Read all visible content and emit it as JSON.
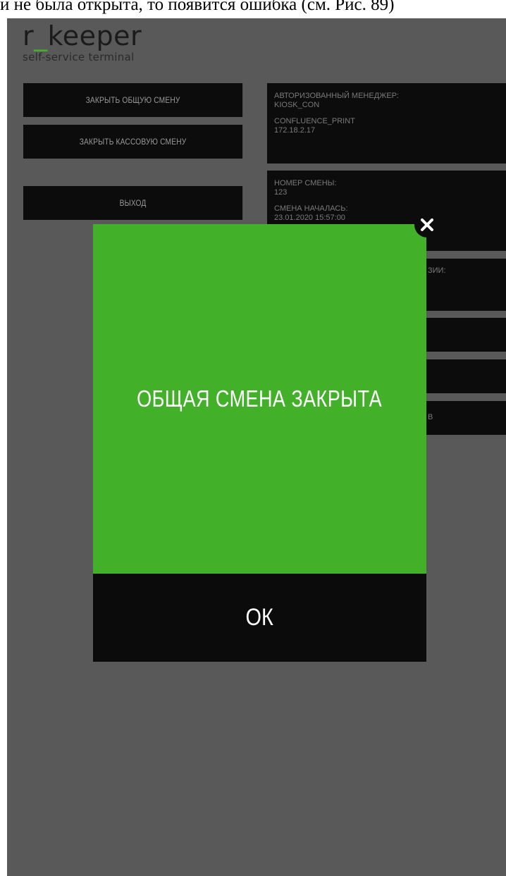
{
  "caption": "и не была открыта, то появится ошибка (см. Рис. 89)",
  "logo": {
    "brand_prefix": "r",
    "brand_underscore": "_",
    "brand_suffix": "keeper",
    "tagline": "self-service terminal"
  },
  "menu": {
    "close_general_shift": "ЗАКРЫТЬ ОБЩУЮ СМЕНУ",
    "close_cash_shift": "ЗАКРЫТЬ КАССОВУЮ СМЕНУ",
    "exit": "ВЫХОД"
  },
  "info": {
    "manager_label": "АВТОРИЗОВАННЫЙ МЕНЕДЖЕР:",
    "manager_value": "KIOSK_CON",
    "printer_label": "CONFLUENCE_PRINT",
    "printer_value": "172.18.2.17",
    "shift_number_label": "НОМЕР СМЕНЫ:",
    "shift_number_value": "123",
    "shift_started_label": "СМЕНА НАЧАЛАСЬ:",
    "shift_started_value": "23.01.2020 15:57:00",
    "partial_label": "ЗИИ:",
    "partial_button": "В"
  },
  "modal": {
    "message": "ОБЩАЯ СМЕНА ЗАКРЫТА",
    "ok_label": "ОК",
    "close_icon": "close-icon"
  },
  "colors": {
    "accent": "#43b02a",
    "background": "#595959",
    "panel": "#0c0c0c"
  }
}
